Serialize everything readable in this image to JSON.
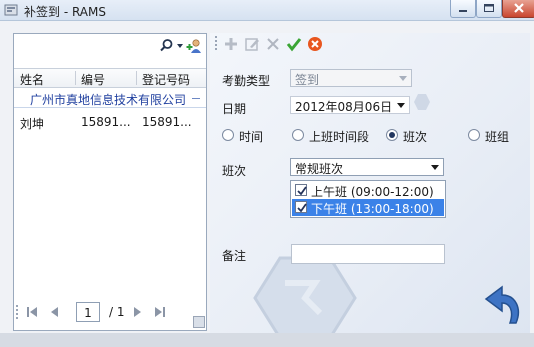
{
  "window": {
    "title": "补签到 - RAMS"
  },
  "search": {
    "value": ""
  },
  "list": {
    "headers": [
      "姓名",
      "编号",
      "登记号码"
    ],
    "group": "广州市真地信息技术有限公司",
    "rows": [
      {
        "name": "刘坤",
        "number": "15891...",
        "reg": "15891..."
      }
    ]
  },
  "pager": {
    "current": "1",
    "total": "/ 1"
  },
  "toolbar": {
    "icons": [
      "add-icon",
      "edit-icon",
      "delete-icon",
      "confirm-icon",
      "cancel-icon"
    ]
  },
  "form": {
    "attendance_type_label": "考勤类型",
    "attendance_type_value": "签到",
    "date_label": "日期",
    "date_value": "2012年08月06日",
    "radio_options": [
      {
        "label": "时间",
        "checked": false
      },
      {
        "label": "上班时间段",
        "checked": false
      },
      {
        "label": "班次",
        "checked": true
      },
      {
        "label": "班组",
        "checked": false
      }
    ],
    "shift_label": "班次",
    "shift_value": "常规班次",
    "shifts": [
      {
        "label": "上午班 (09:00-12:00)",
        "checked": true,
        "selected": false
      },
      {
        "label": "下午班 (13:00-18:00)",
        "checked": true,
        "selected": true
      }
    ],
    "note_label": "备注",
    "note_value": ""
  },
  "colors": {
    "accent": "#3b82e8",
    "group_text": "#1f3f9f",
    "confirm": "#3aa535",
    "cancel": "#e8561f"
  }
}
